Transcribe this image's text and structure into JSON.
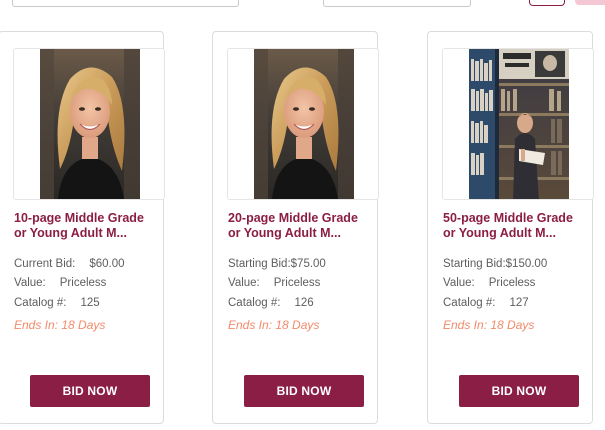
{
  "top_controls": {
    "search_field": "",
    "sort_select": "",
    "view_buttons": [
      "",
      ""
    ]
  },
  "items": [
    {
      "title_line1": "10-page Middle Grade",
      "title_line2": "or Young Adult M...",
      "bid_label": "Current Bid:",
      "bid_value": "$60.00",
      "value_label": "Value:",
      "value_value": "Priceless",
      "catalog_label": "Catalog #:",
      "catalog_value": "125",
      "ends": "Ends In: 18 Days",
      "button": "BID NOW",
      "image": "portrait-woman"
    },
    {
      "title_line1": "20-page Middle Grade",
      "title_line2": "or Young Adult M...",
      "bid_label": "Starting Bid:",
      "bid_value": "$75.00",
      "value_label": "Value:",
      "value_value": "Priceless",
      "catalog_label": "Catalog #:",
      "catalog_value": "126",
      "ends": "Ends In: 18 Days",
      "button": "BID NOW",
      "image": "portrait-woman"
    },
    {
      "title_line1": "50-page Middle Grade",
      "title_line2": "or Young Adult M...",
      "bid_label": "Starting Bid:",
      "bid_value": "$150.00",
      "value_label": "Value:",
      "value_value": "Priceless",
      "catalog_label": "Catalog #:",
      "catalog_value": "127",
      "ends": "Ends In: 18 Days",
      "button": "BID NOW",
      "image": "man-in-bookstore"
    }
  ],
  "colors": {
    "brand": "#8b1e44",
    "ends": "#f28a6a",
    "meta_text": "#5e5e5e"
  }
}
